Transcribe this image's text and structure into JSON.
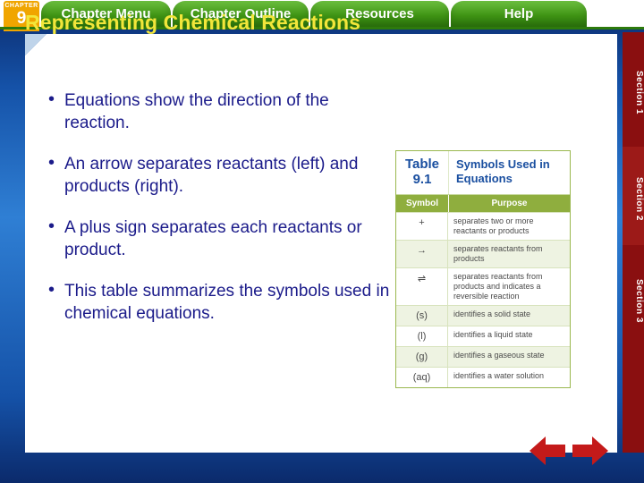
{
  "topbar": {
    "chapter_badge": {
      "word": "CHAPTER",
      "number": "9"
    },
    "tabs": [
      {
        "label": "Chapter Menu"
      },
      {
        "label": "Chapter Outline"
      },
      {
        "label": "Resources"
      },
      {
        "label": "Help"
      }
    ]
  },
  "side_tabs": [
    {
      "label": "Section 1"
    },
    {
      "label": "Section 2"
    },
    {
      "label": "Section 3"
    }
  ],
  "slide": {
    "title": "Representing Chemical Reactions",
    "bullets": [
      "Equations show the direction of the reaction.",
      "An arrow separates reactants (left) and products (right).",
      "A plus sign separates each reactants or product.",
      "This table summarizes the symbols used in chemical equations."
    ]
  },
  "table_image": {
    "label_word": "Table",
    "label_number": "9.1",
    "title": "Symbols Used in Equations",
    "columns": [
      "Symbol",
      "Purpose"
    ],
    "rows": [
      {
        "symbol": "+",
        "purpose": "separates two or more reactants or products"
      },
      {
        "symbol": "→",
        "purpose": "separates reactants from products"
      },
      {
        "symbol": "⇌",
        "purpose": "separates reactants from products and indicates a reversible reaction"
      },
      {
        "symbol": "(s)",
        "purpose": "identifies a solid state"
      },
      {
        "symbol": "(l)",
        "purpose": "identifies a liquid state"
      },
      {
        "symbol": "(g)",
        "purpose": "identifies a gaseous state"
      },
      {
        "symbol": "(aq)",
        "purpose": "identifies a water solution"
      }
    ]
  },
  "nav": {
    "previous_label": "previous-slide-arrow",
    "next_label": "next-slide-arrow",
    "arrow_color": "#c41a1a"
  }
}
